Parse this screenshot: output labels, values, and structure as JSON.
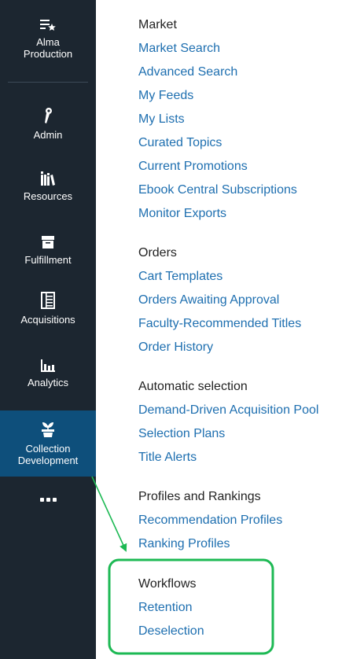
{
  "sidebar": {
    "items": [
      {
        "label": "Alma\nProduction",
        "icon": "list-star-icon"
      },
      {
        "label": "Admin",
        "icon": "admin-pen-icon"
      },
      {
        "label": "Resources",
        "icon": "resources-books-icon"
      },
      {
        "label": "Fulfillment",
        "icon": "fulfillment-box-icon"
      },
      {
        "label": "Acquisitions",
        "icon": "acquisitions-ledger-icon"
      },
      {
        "label": "Analytics",
        "icon": "analytics-bars-icon"
      },
      {
        "label": "Collection\nDevelopment",
        "icon": "collection-plant-icon",
        "active": true
      }
    ],
    "more_icon": "more-icon"
  },
  "menu": {
    "sections": [
      {
        "title": "Market",
        "links": [
          "Market Search",
          "Advanced Search",
          "My Feeds",
          "My Lists",
          "Curated Topics",
          "Current Promotions",
          "Ebook Central Subscriptions",
          "Monitor Exports"
        ]
      },
      {
        "title": "Orders",
        "links": [
          "Cart Templates",
          "Orders Awaiting Approval",
          "Faculty-Recommended Titles",
          "Order History"
        ]
      },
      {
        "title": "Automatic selection",
        "links": [
          "Demand-Driven Acquisition Pool",
          "Selection Plans",
          "Title Alerts"
        ]
      },
      {
        "title": "Profiles and Rankings",
        "links": [
          "Recommendation Profiles",
          "Ranking Profiles"
        ]
      },
      {
        "title": "Workflows",
        "links": [
          "Retention",
          "Deselection"
        ]
      }
    ]
  },
  "colors": {
    "sidebar_bg": "#1c2630",
    "active_bg": "#0e4f7b",
    "link": "#1e6fb0",
    "highlight": "#1db954"
  }
}
